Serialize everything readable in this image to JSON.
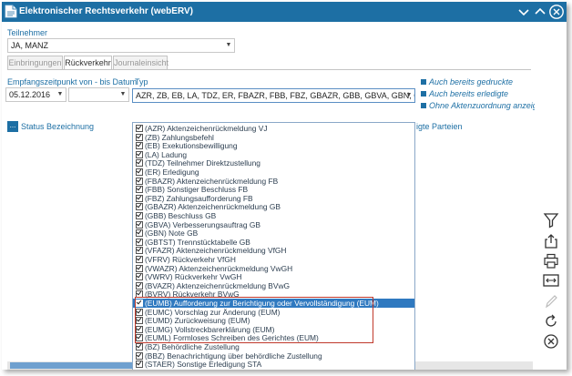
{
  "window": {
    "title": "Elektronischer Rechtsverkehr (webERV)"
  },
  "teilnehmer": {
    "label": "Teilnehmer",
    "value": "JA, MANZ"
  },
  "tabs": [
    {
      "label": "Einbringungen",
      "active": false
    },
    {
      "label": "Rückverkehr",
      "active": true
    },
    {
      "label": "Journaleinsicht",
      "active": false
    }
  ],
  "filters": {
    "date_label": "Empfangszeitpunkt von - bis Datum",
    "date_from": "05.12.2016",
    "date_to": "",
    "typ_label": "Typ",
    "typ_value": "AZR, ZB, EB, LA, TDZ, ER, FBAZR, FBB, FBZ, GBAZR, GBB, GBVA, GBN, GBTST, VFAZR,"
  },
  "options": [
    "Auch bereits gedruckte",
    "Auch bereits erledigte",
    "Ohne Aktenzuordnung anzeigen"
  ],
  "table": {
    "more_button": "...",
    "columns": [
      "Status",
      "Bezeichnung"
    ],
    "partial_column": "igte Parteien"
  },
  "typ_options": [
    {
      "label": "(AZR) Aktenzeichenrückmeldung VJ",
      "checked": true
    },
    {
      "label": "(ZB) Zahlungsbefehl",
      "checked": true
    },
    {
      "label": "(EB) Exekutionsbewilligung",
      "checked": true
    },
    {
      "label": "(LA) Ladung",
      "checked": true
    },
    {
      "label": "(TDZ) Teilnehmer Direktzustellung",
      "checked": true
    },
    {
      "label": "(ER) Erledigung",
      "checked": true
    },
    {
      "label": "(FBAZR) Aktenzeichenrückmeldung FB",
      "checked": true
    },
    {
      "label": "(FBB) Sonstiger Beschluss FB",
      "checked": true
    },
    {
      "label": "(FBZ) Zahlungsaufforderung FB",
      "checked": true
    },
    {
      "label": "(GBAZR) Aktenzeichenrückmeldung GB",
      "checked": true
    },
    {
      "label": "(GBB) Beschluss GB",
      "checked": true
    },
    {
      "label": "(GBVA) Verbesserungsauftrag GB",
      "checked": true
    },
    {
      "label": "(GBN) Note GB",
      "checked": true
    },
    {
      "label": "(GBTST) Trennstücktabelle GB",
      "checked": true
    },
    {
      "label": "(VFAZR) Aktenzeichenrückmeldung VfGH",
      "checked": true
    },
    {
      "label": "(VFRV) Rückverkehr VfGH",
      "checked": true
    },
    {
      "label": "(VWAZR) Aktenzeichenrückmeldung VwGH",
      "checked": true
    },
    {
      "label": "(VWRV) Rückverkehr VwGH",
      "checked": true
    },
    {
      "label": "(BVAZR) Aktenzeichenrückmeldung BVwG",
      "checked": true
    },
    {
      "label": "(BVRV) Rückverkehr BVwG",
      "checked": true
    },
    {
      "label": "(EUMB) Aufforderung zur Berichtigung oder Vervollständigung (EUM)",
      "checked": true,
      "selected": true
    },
    {
      "label": "(EUMC) Vorschlag zur Änderung (EUM)",
      "checked": true
    },
    {
      "label": "(EUMD) Zurückweisung (EUM)",
      "checked": true
    },
    {
      "label": "(EUMG) Vollstreckbarerklärung (EUM)",
      "checked": true
    },
    {
      "label": "(EUML) Formloses Schreiben des Gerichtes (EUM)",
      "checked": true
    },
    {
      "label": "(BZ) Behördliche Zustellung",
      "checked": true
    },
    {
      "label": "(BBZ) Benachrichtigung über behördliche Zustellung",
      "checked": true
    },
    {
      "label": "(STAER) Sonstige Erledigung STA",
      "checked": true
    }
  ],
  "colors": {
    "accent": "#1d6fa4",
    "selection": "#2f79c0",
    "highlight_border": "#c0392b"
  },
  "sidebar_icons": [
    "filter-icon",
    "export-icon",
    "print-icon",
    "columns-icon",
    "edit-icon",
    "refresh-icon",
    "cancel-icon"
  ]
}
